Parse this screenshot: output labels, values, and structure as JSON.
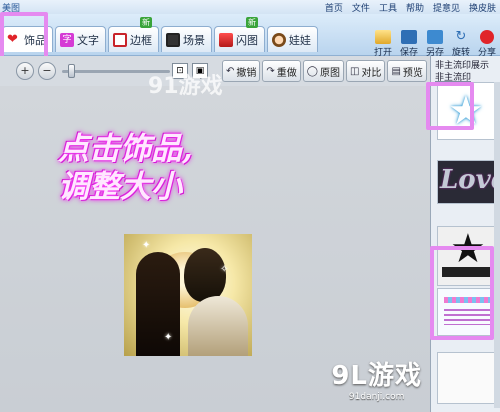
{
  "app": {
    "logo": "美图"
  },
  "top_menu": [
    "首页",
    "文件",
    "工具",
    "帮助",
    "提意见",
    "换皮肤"
  ],
  "tabs": [
    {
      "label": "饰品",
      "active": true,
      "badge": ""
    },
    {
      "label": "文字",
      "active": false,
      "badge": ""
    },
    {
      "label": "边框",
      "active": false,
      "badge": "新"
    },
    {
      "label": "场景",
      "active": false,
      "badge": ""
    },
    {
      "label": "闪图",
      "active": false,
      "badge": "新"
    },
    {
      "label": "娃娃",
      "active": false,
      "badge": ""
    }
  ],
  "right_tools": [
    "打开",
    "保存",
    "另存",
    "旋转",
    "分享"
  ],
  "edit_actions": [
    "撤销",
    "重做",
    "原图",
    "对比",
    "预览"
  ],
  "zoom": {
    "in_symbol": "+",
    "out_symbol": "−"
  },
  "canvas": {
    "caption_line1": "点击饰品,",
    "caption_line2": "调整大小",
    "watermark_top": "91游戏"
  },
  "panel": {
    "header": "非主流印展示",
    "tab": "非主流印"
  },
  "watermark": {
    "logo": "9L游戏",
    "url": "91danji.com"
  },
  "colors": {
    "highlight": "#e58af0",
    "caption_glow": "#e018e0",
    "toolbar": "#b9d4ee"
  }
}
